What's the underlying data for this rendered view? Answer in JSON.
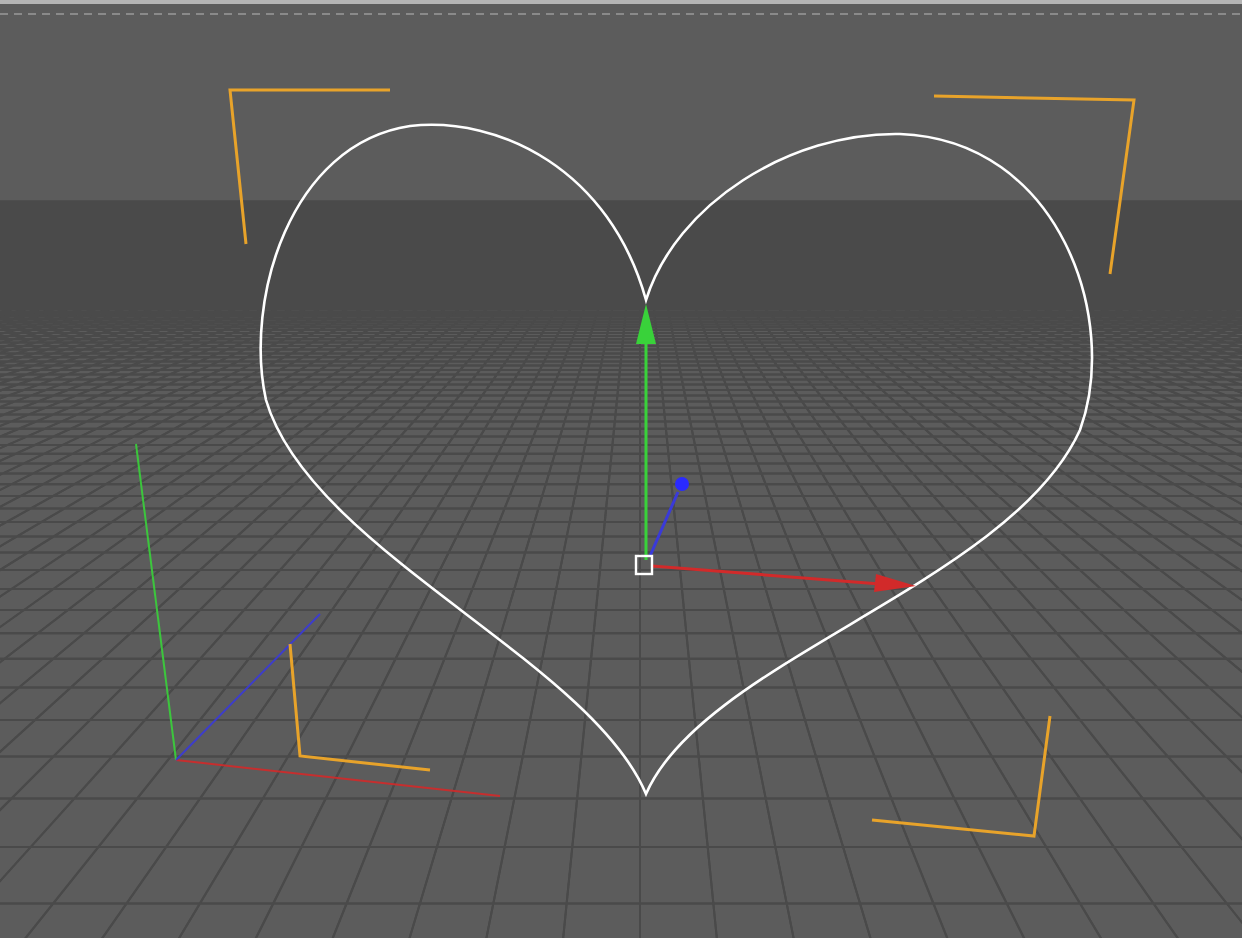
{
  "viewport": {
    "object": {
      "kind": "heart-spline",
      "selected": true
    }
  }
}
